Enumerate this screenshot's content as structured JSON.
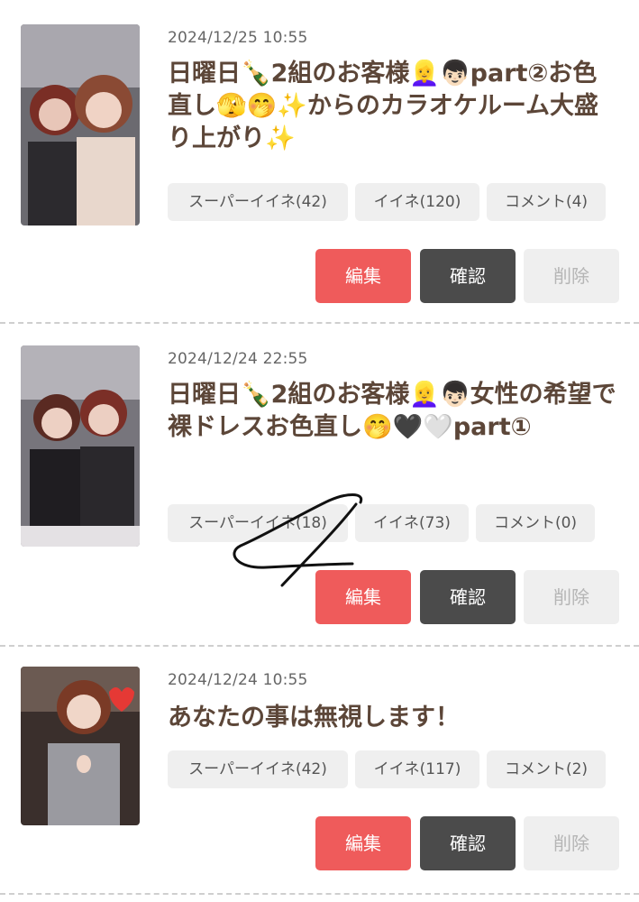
{
  "posts": [
    {
      "date": "2024/12/25 10:55",
      "title": "日曜日🍾2組のお客様👱‍♀️👦🏻part②お色直し🫣🤭✨からのカラオケルーム大盛り上がり✨",
      "chips": {
        "super_like": "スーパーイイネ(42)",
        "like": "イイネ(120)",
        "comment": "コメント(4)"
      },
      "buttons": {
        "edit": "編集",
        "confirm": "確認",
        "delete": "削除"
      }
    },
    {
      "date": "2024/12/24 22:55",
      "title": "日曜日🍾2組のお客様👱‍♀️👦🏻女性の希望で裸ドレスお色直し🤭🖤🤍part①",
      "chips": {
        "super_like": "スーパーイイネ(18)",
        "like": "イイネ(73)",
        "comment": "コメント(0)"
      },
      "buttons": {
        "edit": "編集",
        "confirm": "確認",
        "delete": "削除"
      }
    },
    {
      "date": "2024/12/24 10:55",
      "title": "あなたの事は無視します！",
      "chips": {
        "super_like": "スーパーイイネ(42)",
        "like": "イイネ(117)",
        "comment": "コメント(2)"
      },
      "buttons": {
        "edit": "編集",
        "confirm": "確認",
        "delete": "削除"
      }
    }
  ],
  "colors": {
    "edit": "#ef5b5b",
    "confirm": "#4b4b4b",
    "delete": "#efefef",
    "title": "#5c4638"
  }
}
